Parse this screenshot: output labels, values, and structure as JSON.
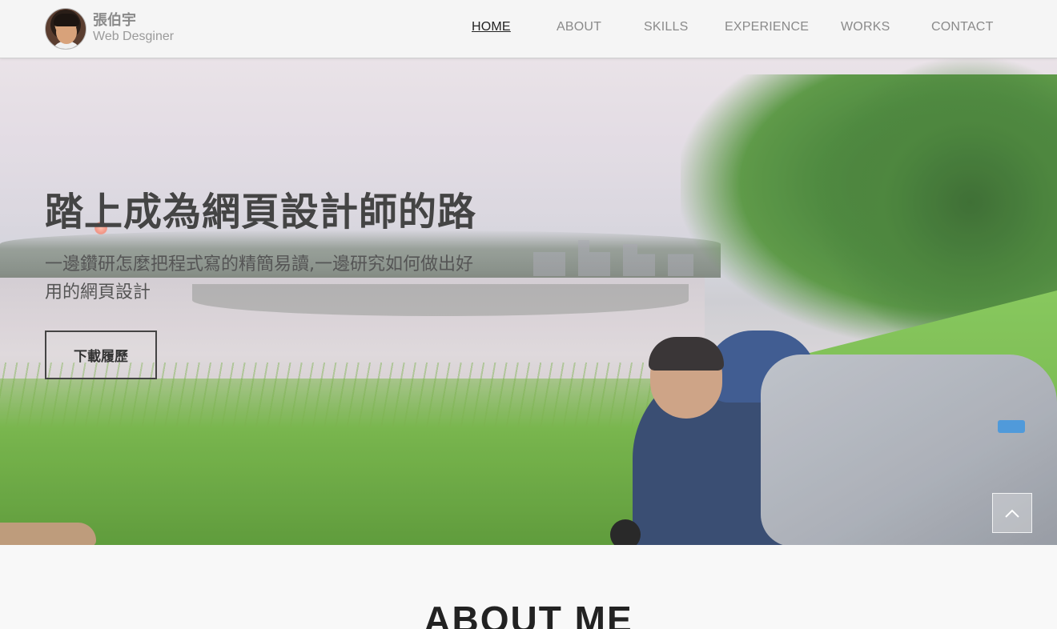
{
  "brand": {
    "name": "張伯宇",
    "role": "Web Desginer"
  },
  "nav": {
    "items": [
      {
        "label": "HOME",
        "active": true
      },
      {
        "label": "ABOUT",
        "active": false
      },
      {
        "label": "SKILLS",
        "active": false
      },
      {
        "label": "EXPERIENCE",
        "active": false
      },
      {
        "label": "WORKS",
        "active": false
      },
      {
        "label": "CONTACT",
        "active": false
      }
    ]
  },
  "hero": {
    "title": "踏上成為網頁設計師的路",
    "subtitle_line1": "一邊鑽研怎麼把程式寫的精簡易讀,一邊研究如何做出好",
    "subtitle_line2": "用的網頁設計",
    "cta_label": "下載履歷"
  },
  "about": {
    "title": "ABOUT ME"
  },
  "icons": {
    "back_to_top": "chevron-up-icon"
  }
}
